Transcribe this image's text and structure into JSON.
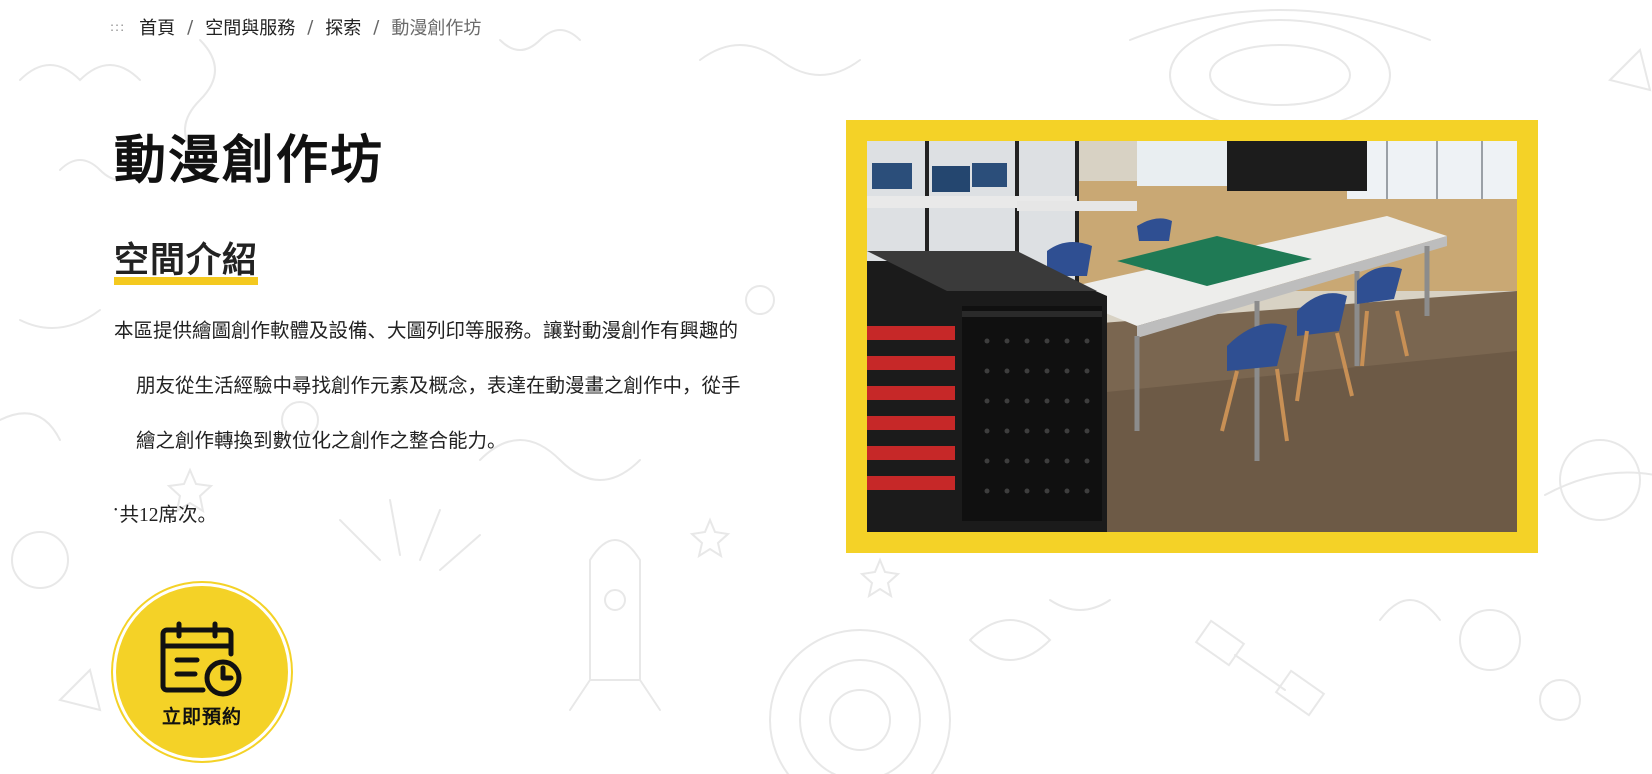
{
  "breadcrumb": {
    "items": [
      "首頁",
      "空間與服務",
      "探索"
    ],
    "current": "動漫創作坊",
    "separator": "/"
  },
  "page": {
    "title": "動漫創作坊"
  },
  "intro": {
    "heading": "空間介紹",
    "description": "本區提供繪圖創作軟體及設備、大圖列印等服務。讓對動漫創作有興趣的朋友從生活經驗中尋找創作元素及概念，表達在動漫畫之創作中，從手繪之創作轉換到數位化之創作之整合能力。",
    "seats": "共12席次。",
    "seats_bullet": "•"
  },
  "photo": {
    "alt": "動漫創作坊空間照片",
    "frame_color": "#f4d227"
  },
  "reserve": {
    "label": "立即預約",
    "icon": "calendar-clock-icon",
    "color": "#f4d227"
  },
  "colors": {
    "accent": "#f4d227",
    "doodle": "#e9e9e9"
  }
}
